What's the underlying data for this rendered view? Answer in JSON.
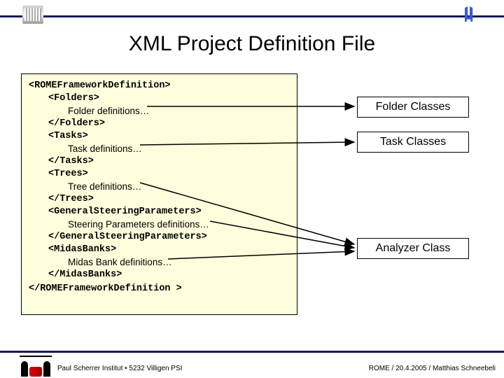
{
  "title": "XML Project Definition File",
  "code": {
    "open_root": "<ROMEFrameworkDefinition>",
    "open_folders": "<Folders>",
    "folder_def": "Folder definitions…",
    "close_folders": "</Folders>",
    "open_tasks": "<Tasks>",
    "task_def": "Task definitions…",
    "close_tasks": "</Tasks>",
    "open_trees": "<Trees>",
    "tree_def": "Tree definitions…",
    "close_trees": "</Trees>",
    "open_gsp": "<GeneralSteeringParameters>",
    "gsp_def": "Steering Parameters definitions…",
    "close_gsp": "</GeneralSteeringParameters>",
    "open_midas": "<MidasBanks>",
    "midas_def": "Midas Bank definitions…",
    "close_midas": "</MidasBanks>",
    "close_root": "</ROMEFrameworkDefinition >"
  },
  "labels": {
    "folder": "Folder Classes",
    "task": "Task Classes",
    "analyzer": "Analyzer Class"
  },
  "footer": {
    "left": "Paul Scherrer Institut • 5232 Villigen PSI",
    "right": "ROME / 20.4.2005 / Matthias Schneebeli"
  }
}
